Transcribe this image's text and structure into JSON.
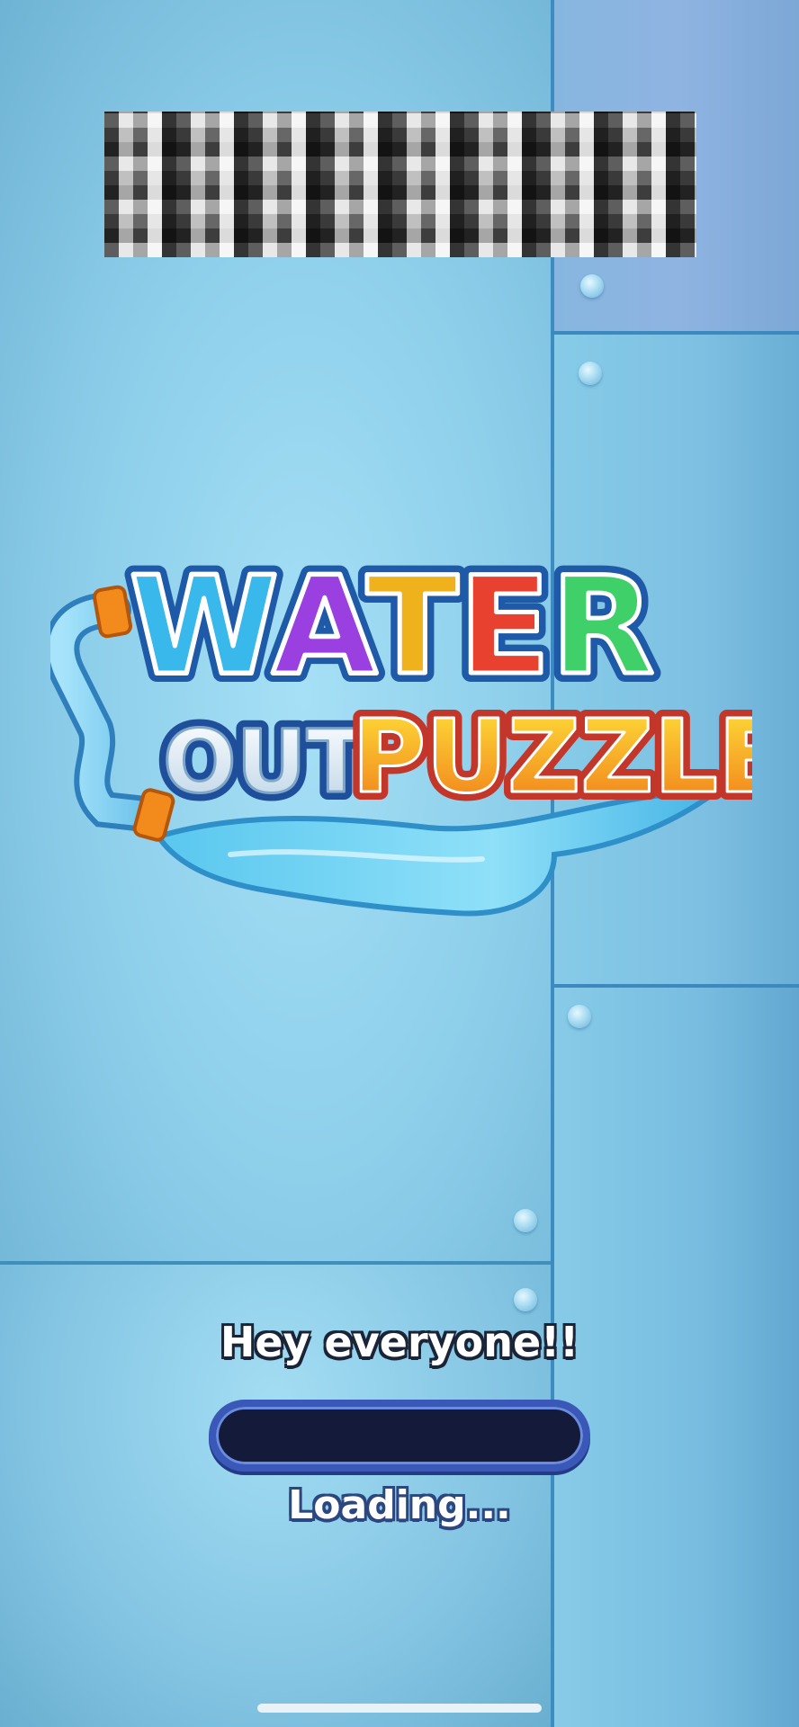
{
  "logo": {
    "title_word1": "WATER",
    "title_word2": "OUT",
    "title_word3": "PUZZLE",
    "letter_colors": [
      "#34b4ea",
      "#34b4ea",
      "#9a3fe0",
      "#f0b21c",
      "#e8412f",
      "#3fd06a"
    ]
  },
  "greeting": "Hey everyone!!",
  "loading": {
    "label": "Loading...",
    "progress": 0.0
  },
  "colors": {
    "progress_bg": "#141a3a",
    "progress_border": "#3a58b8",
    "puzzle_gradient_top": "#ffe23a",
    "puzzle_gradient_bottom": "#f07a18"
  }
}
